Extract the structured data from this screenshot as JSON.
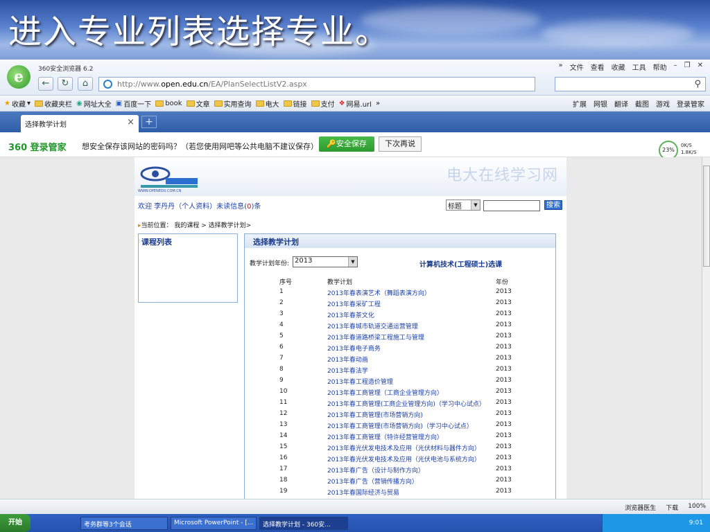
{
  "slide_title": "进入专业列表选择专业。",
  "browser": {
    "version": "360安全浏览器 6.2",
    "menu": [
      "»",
      "文件",
      "查看",
      "收藏",
      "工具",
      "帮助"
    ],
    "url_prefix": "http://www.",
    "url_domain": "open.edu.cn",
    "url_path": "/EA/PlanSelectListV2.aspx",
    "favorites": [
      "收藏",
      "收藏夹栏",
      "网址大全",
      "百度一下",
      "book",
      "文章",
      "实用查询",
      "电大",
      "链接",
      "支付",
      "网易.url",
      "»"
    ],
    "fav_right": [
      "扩展",
      "网银",
      "翻译",
      "截图",
      "游戏",
      "登录管家"
    ],
    "tab_title": "选择教学计划",
    "notif_brand": "360 登录管家",
    "notif_text": "想安全保存该网站的密码吗？（若您使用网吧等公共电脑不建议保存）",
    "notif_save": "安全保存",
    "notif_later": "下次再说",
    "speed_pct": "23%",
    "speed_up": "0K/S",
    "speed_down": "1.8K/S"
  },
  "site": {
    "logo_text": "WWW.OPENEDU.COM.CN",
    "name": "电大在线学习网",
    "welcome": "欢迎 李丹丹（个人资料）未读信息(",
    "unread": "0",
    "welcome_end": ")条",
    "search_field": "标题",
    "search_btn": "搜索",
    "breadcrumb_mark": "▸",
    "breadcrumb": "当前位置： 我的课程 > 选择教学计划>",
    "course_panel_title": "课程列表",
    "plan_panel_title": "选择教学计划",
    "year_label": "教学计划年份:",
    "year_value": "2013",
    "major_name": "计算机技术(工程硕士)选课",
    "table_headers": [
      "序号",
      "教学计划",
      "年份"
    ],
    "rows": [
      {
        "no": "1",
        "plan": "2013年春表演艺术（舞蹈表演方向）",
        "year": "2013"
      },
      {
        "no": "2",
        "plan": "2013年春采矿工程",
        "year": "2013"
      },
      {
        "no": "3",
        "plan": "2013年春茶文化",
        "year": "2013"
      },
      {
        "no": "4",
        "plan": "2013年春城市轨道交通运营管理",
        "year": "2013"
      },
      {
        "no": "5",
        "plan": "2013年春道路桥梁工程施工与管理",
        "year": "2013"
      },
      {
        "no": "6",
        "plan": "2013年春电子商务",
        "year": "2013"
      },
      {
        "no": "7",
        "plan": "2013年春动画",
        "year": "2013"
      },
      {
        "no": "8",
        "plan": "2013年春法学",
        "year": "2013"
      },
      {
        "no": "9",
        "plan": "2013年春工程造价管理",
        "year": "2013"
      },
      {
        "no": "10",
        "plan": "2013年春工商管理（工商企业管理方向）",
        "year": "2013"
      },
      {
        "no": "11",
        "plan": "2013年春工商管理(工商企业管理方向)（学习中心试点）",
        "year": "2013"
      },
      {
        "no": "12",
        "plan": "2013年春工商管理(市场营销方向)",
        "year": "2013"
      },
      {
        "no": "13",
        "plan": "2013年春工商管理(市场营销方向)（学习中心试点）",
        "year": "2013"
      },
      {
        "no": "14",
        "plan": "2013年春工商管理（特许经营管理方向）",
        "year": "2013"
      },
      {
        "no": "15",
        "plan": "2013年春光伏发电技术及应用（光伏材料与器件方向）",
        "year": "2013"
      },
      {
        "no": "16",
        "plan": "2013年春光伏发电技术及应用（光伏电池与系统方向）",
        "year": "2013"
      },
      {
        "no": "17",
        "plan": "2013年春广告（设计与制作方向）",
        "year": "2013"
      },
      {
        "no": "18",
        "plan": "2013年春广告（营销传播方向）",
        "year": "2013"
      },
      {
        "no": "19",
        "plan": "2013年春国际经济与贸易",
        "year": "2013"
      }
    ]
  },
  "status": [
    "浏览器医生",
    "下载",
    "100%"
  ],
  "taskbar": {
    "start": "开始",
    "tasks": [
      "考务群等3个会话",
      "Microsoft PowerPoint - [...",
      "选择教学计划 - 360安..."
    ],
    "clock": "9:01"
  }
}
